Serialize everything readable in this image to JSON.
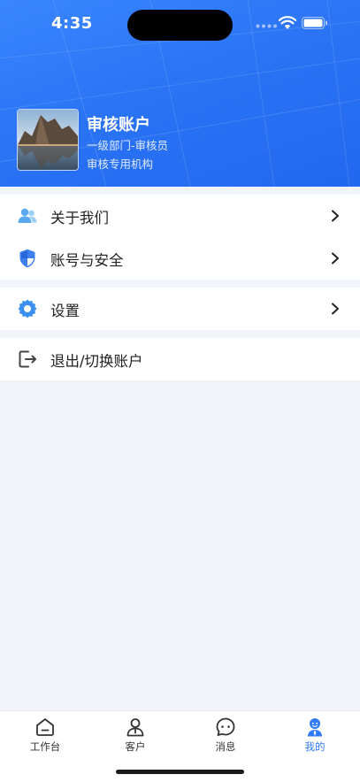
{
  "status_bar": {
    "time": "4:35"
  },
  "profile": {
    "name": "审核账户",
    "department_role": "一级部门-审核员",
    "organization": "审核专用机构"
  },
  "menu": {
    "about_us": "关于我们",
    "account_security": "账号与安全",
    "settings": "设置",
    "logout_switch": "退出/切换账户"
  },
  "tabbar": {
    "tabs": [
      {
        "label": "工作台",
        "icon": "home-icon",
        "active": false
      },
      {
        "label": "客户",
        "icon": "person-icon",
        "active": false
      },
      {
        "label": "消息",
        "icon": "chat-bubble-icon",
        "active": false
      },
      {
        "label": "我的",
        "icon": "profile-icon",
        "active": true
      }
    ]
  },
  "colors": {
    "brand_blue": "#2b74f5",
    "active_tab": "#2f7bf5",
    "background": "#f1f4f8"
  }
}
